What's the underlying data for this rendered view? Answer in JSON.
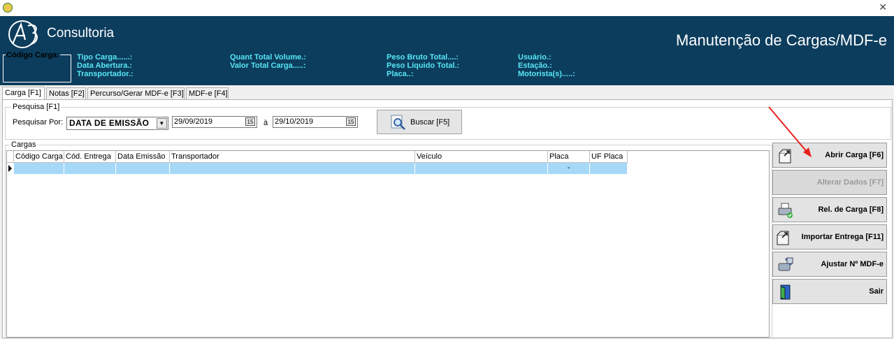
{
  "window": {
    "close_glyph": "✕"
  },
  "header": {
    "logo_text": "Consultoria",
    "title": "Manutenção de Cargas/MDF-e",
    "codigo_carga_label": "Código Carga:",
    "info": {
      "col1": [
        "Tipo Carga......:",
        "Data Abertura.:",
        "Transportador.:"
      ],
      "col2": [
        "Quant Total Volume.:",
        "Valor Total Carga.....:"
      ],
      "col3": [
        "Peso Bruto Total....:",
        "Peso Líquido Total.:",
        "Placa..:"
      ],
      "col4": [
        "Usuário.:",
        "Estação.:",
        "Motorista(s).....:"
      ]
    },
    "info_color": "#58e6f6",
    "background_color": "#0c3d5d"
  },
  "tabs": [
    "Carga [F1]",
    "Notas [F2]",
    "Percurso/Gerar MDF-e [F3]",
    "MDF-e [F4]"
  ],
  "active_tab": "Carga [F1]",
  "search": {
    "group_label": "Pesquisa [F1]",
    "pesquisar_por_label": "Pesquisar Por:",
    "pesquisar_por_value": "DATA DE EMISSÃO",
    "date_from": "29/09/2019",
    "separator": "à",
    "date_to": "29/10/2019",
    "calendar_glyph": "15",
    "buscar_label": "Buscar [F5]"
  },
  "grid": {
    "group_label": "Cargas",
    "columns": [
      "Código Carga",
      "Cód. Entrega",
      "Data Emissão",
      "Transportador",
      "Veículo",
      "Placa",
      "UF Placa"
    ],
    "rows": [
      [
        "",
        "",
        "",
        "",
        "",
        "-",
        ""
      ]
    ]
  },
  "side_buttons": [
    {
      "label": "Abrir Carga [F6]",
      "icon": "open-folder-icon",
      "enabled": true
    },
    {
      "label": "Alterar Dados [F7]",
      "icon": "none",
      "enabled": false
    },
    {
      "label": "Rel. de Carga [F8]",
      "icon": "printer-icon",
      "enabled": true
    },
    {
      "label": "Importar Entrega [F11]",
      "icon": "import-folder-icon",
      "enabled": true
    },
    {
      "label": "Ajustar Nº MDF-e",
      "icon": "tools-icon",
      "enabled": true
    },
    {
      "label": "Sair",
      "icon": "exit-door-icon",
      "enabled": true
    }
  ],
  "annotation_arrow_color": "#e8201a"
}
